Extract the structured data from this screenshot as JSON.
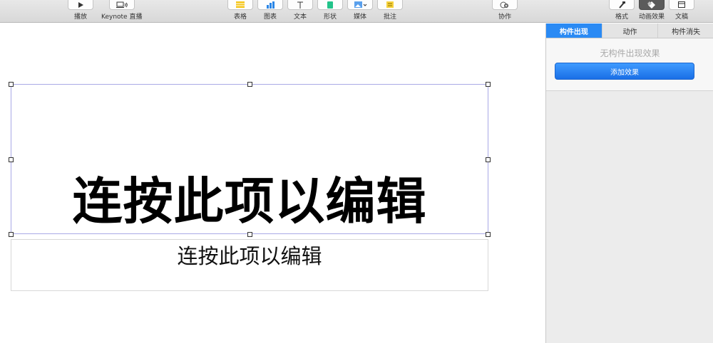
{
  "toolbar": {
    "play_label": "播放",
    "keynote_live_label": "Keynote 直播",
    "table_label": "表格",
    "chart_label": "图表",
    "text_label": "文本",
    "shape_label": "形状",
    "media_label": "媒体",
    "comment_label": "批注",
    "collaborate_label": "协作",
    "format_label": "格式",
    "animate_label": "动画效果",
    "document_label": "文稿"
  },
  "slide": {
    "title_placeholder": "连按此项以编辑",
    "subtitle_placeholder": "连按此项以编辑"
  },
  "animate_panel": {
    "tabs": [
      {
        "label": "构件出现",
        "active": true
      },
      {
        "label": "动作",
        "active": false
      },
      {
        "label": "构件消失",
        "active": false
      }
    ],
    "empty_message": "无构件出现效果",
    "add_effect_label": "添加效果"
  },
  "colors": {
    "accent": "#2a8af4",
    "selection_border": "#a9a9e6"
  }
}
